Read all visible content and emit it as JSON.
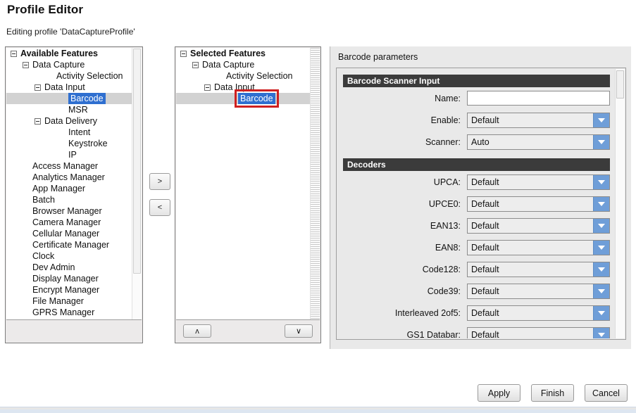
{
  "header": {
    "title": "Profile Editor",
    "subtitle": "Editing profile 'DataCaptureProfile'"
  },
  "available_features": {
    "tree": [
      {
        "label": "Available Features",
        "indent": 0,
        "toggle": true,
        "bold": true,
        "selected": false
      },
      {
        "label": "Data Capture",
        "indent": 1,
        "toggle": true,
        "bold": false,
        "selected": false
      },
      {
        "label": "Activity Selection",
        "indent": 3,
        "toggle": false,
        "bold": false,
        "selected": false
      },
      {
        "label": "Data Input",
        "indent": 2,
        "toggle": true,
        "bold": false,
        "selected": false
      },
      {
        "label": "Barcode",
        "indent": 4,
        "toggle": false,
        "bold": false,
        "selected": true
      },
      {
        "label": "MSR",
        "indent": 4,
        "toggle": false,
        "bold": false,
        "selected": false
      },
      {
        "label": "Data Delivery",
        "indent": 2,
        "toggle": true,
        "bold": false,
        "selected": false
      },
      {
        "label": "Intent",
        "indent": 4,
        "toggle": false,
        "bold": false,
        "selected": false
      },
      {
        "label": "Keystroke",
        "indent": 4,
        "toggle": false,
        "bold": false,
        "selected": false
      },
      {
        "label": "IP",
        "indent": 4,
        "toggle": false,
        "bold": false,
        "selected": false
      },
      {
        "label": "Access Manager",
        "indent": 1,
        "toggle": false,
        "bold": false,
        "selected": false
      },
      {
        "label": "Analytics Manager",
        "indent": 1,
        "toggle": false,
        "bold": false,
        "selected": false
      },
      {
        "label": "App Manager",
        "indent": 1,
        "toggle": false,
        "bold": false,
        "selected": false
      },
      {
        "label": "Batch",
        "indent": 1,
        "toggle": false,
        "bold": false,
        "selected": false
      },
      {
        "label": "Browser Manager",
        "indent": 1,
        "toggle": false,
        "bold": false,
        "selected": false
      },
      {
        "label": "Camera Manager",
        "indent": 1,
        "toggle": false,
        "bold": false,
        "selected": false
      },
      {
        "label": "Cellular Manager",
        "indent": 1,
        "toggle": false,
        "bold": false,
        "selected": false
      },
      {
        "label": "Certificate Manager",
        "indent": 1,
        "toggle": false,
        "bold": false,
        "selected": false
      },
      {
        "label": "Clock",
        "indent": 1,
        "toggle": false,
        "bold": false,
        "selected": false
      },
      {
        "label": "Dev Admin",
        "indent": 1,
        "toggle": false,
        "bold": false,
        "selected": false
      },
      {
        "label": "Display Manager",
        "indent": 1,
        "toggle": false,
        "bold": false,
        "selected": false
      },
      {
        "label": "Encrypt Manager",
        "indent": 1,
        "toggle": false,
        "bold": false,
        "selected": false
      },
      {
        "label": "File Manager",
        "indent": 1,
        "toggle": false,
        "bold": false,
        "selected": false
      },
      {
        "label": "GPRS Manager",
        "indent": 1,
        "toggle": false,
        "bold": false,
        "selected": false
      }
    ]
  },
  "transfer_buttons": {
    "add_label": ">",
    "remove_label": "<"
  },
  "selected_features": {
    "tree": [
      {
        "label": "Selected Features",
        "indent": 0,
        "toggle": true,
        "bold": true,
        "selected": false,
        "annotated": false
      },
      {
        "label": "Data Capture",
        "indent": 1,
        "toggle": true,
        "bold": false,
        "selected": false,
        "annotated": false
      },
      {
        "label": "Activity Selection",
        "indent": 3,
        "toggle": false,
        "bold": false,
        "selected": false,
        "annotated": false
      },
      {
        "label": "Data Input",
        "indent": 2,
        "toggle": true,
        "bold": false,
        "selected": false,
        "annotated": false
      },
      {
        "label": "Barcode",
        "indent": 4,
        "toggle": false,
        "bold": false,
        "selected": true,
        "annotated": true
      }
    ],
    "move_up_label": "ʌ",
    "move_down_label": "∨"
  },
  "parameters": {
    "caption": "Barcode parameters",
    "sections": [
      {
        "title": "Barcode Scanner Input",
        "fields": [
          {
            "label": "Name:",
            "type": "text",
            "value": "",
            "placeholder": ""
          },
          {
            "label": "Enable:",
            "type": "combo",
            "value": "Default"
          },
          {
            "label": "Scanner:",
            "type": "combo",
            "value": "Auto"
          }
        ]
      },
      {
        "title": "Decoders",
        "fields": [
          {
            "label": "UPCA:",
            "type": "combo",
            "value": "Default"
          },
          {
            "label": "UPCE0:",
            "type": "combo",
            "value": "Default"
          },
          {
            "label": "EAN13:",
            "type": "combo",
            "value": "Default"
          },
          {
            "label": "EAN8:",
            "type": "combo",
            "value": "Default"
          },
          {
            "label": "Code128:",
            "type": "combo",
            "value": "Default"
          },
          {
            "label": "Code39:",
            "type": "combo",
            "value": "Default"
          },
          {
            "label": "Interleaved 2of5:",
            "type": "combo",
            "value": "Default"
          },
          {
            "label": "GS1 Databar:",
            "type": "combo",
            "value": "Default"
          },
          {
            "label": "",
            "type": "combo",
            "value": ""
          }
        ]
      }
    ]
  },
  "footer": {
    "apply_label": "Apply",
    "finish_label": "Finish",
    "cancel_label": "Cancel"
  },
  "colors": {
    "section_header_bg": "#3b3b3b",
    "combo_arrow_bg": "#6f9ed8",
    "selection_blue": "#2f6fd0",
    "selection_band": "#d2d2d2",
    "annotation_red": "#cf2020"
  }
}
